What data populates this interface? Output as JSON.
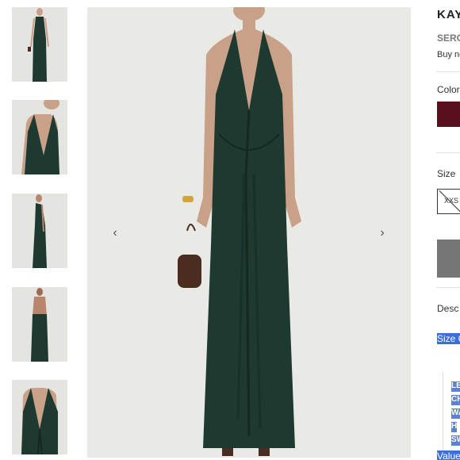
{
  "product": {
    "brand": "KAY",
    "subtitle": "SERO",
    "buy_text": "Buy no"
  },
  "options": {
    "color_label": "Color",
    "color_swatch": "#5a0f1e",
    "size_label": "Size",
    "size_value": "XXS"
  },
  "details": {
    "description_label": "Desc",
    "size_chart_label": "Size C",
    "table_rows": [
      "LEN",
      "CH",
      "WA",
      "H",
      "SW"
    ],
    "footer_text": "Value"
  },
  "gallery": {
    "prev_icon": "‹",
    "next_icon": "›",
    "dress_color": "#1e3a30"
  }
}
